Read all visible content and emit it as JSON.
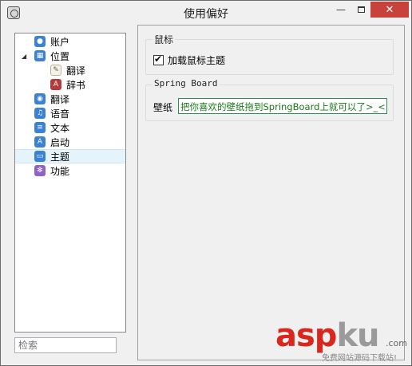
{
  "window": {
    "title": "使用偏好"
  },
  "sidebar": {
    "items": [
      {
        "label": "账户",
        "icon": "user-icon",
        "level": 0
      },
      {
        "label": "位置",
        "icon": "building-icon",
        "level": 0,
        "expanded": true
      },
      {
        "label": "翻译",
        "icon": "translate-paper-icon",
        "level": 1
      },
      {
        "label": "辞书",
        "icon": "dictionary-book-icon",
        "level": 1
      },
      {
        "label": "翻译",
        "icon": "globe-icon",
        "level": 0
      },
      {
        "label": "语音",
        "icon": "music-note-icon",
        "level": 0
      },
      {
        "label": "文本",
        "icon": "document-icon",
        "level": 0
      },
      {
        "label": "启动",
        "icon": "app-store-icon",
        "level": 0
      },
      {
        "label": "主题",
        "icon": "theme-window-icon",
        "level": 0,
        "selected": true
      },
      {
        "label": "功能",
        "icon": "gear-icon",
        "level": 0
      }
    ],
    "search_placeholder": "检索"
  },
  "main": {
    "mouse_group": {
      "legend": "鼠标",
      "checkbox_label": "加载鼠标主题",
      "checked": true
    },
    "springboard_group": {
      "legend": "Spring Board",
      "wallpaper_label": "壁纸",
      "wallpaper_value": "把你喜欢的壁纸拖到SpringBoard上就可以了>_<"
    }
  },
  "watermark": {
    "brand_red": "asp",
    "brand_grey": "ku",
    "suffix": ".com",
    "subtitle": "免费网站源码下载站!"
  },
  "colors": {
    "selection": "#e5f3fb",
    "close_button": "#c7423b",
    "input_text": "#1a7a1a",
    "watermark_red": "#d9271f"
  }
}
